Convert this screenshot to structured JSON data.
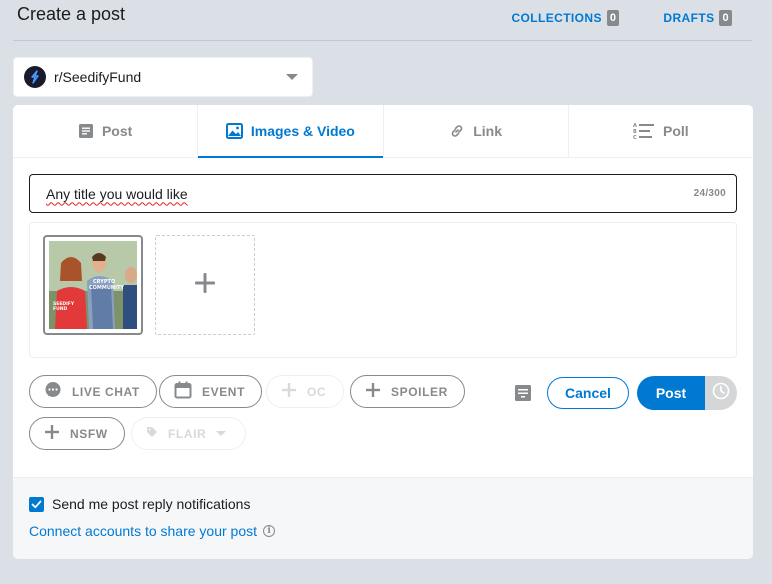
{
  "header": {
    "title": "Create a post",
    "collections_label": "COLLECTIONS",
    "collections_count": "0",
    "drafts_label": "DRAFTS",
    "drafts_count": "0"
  },
  "community": {
    "name": "r/SeedifyFund",
    "icon": "seedify-logo"
  },
  "tabs": [
    {
      "label": "Post",
      "icon": "post-icon",
      "active": false
    },
    {
      "label": "Images & Video",
      "icon": "image-icon",
      "active": true
    },
    {
      "label": "Link",
      "icon": "link-icon",
      "active": false
    },
    {
      "label": "Poll",
      "icon": "poll-icon",
      "active": false
    }
  ],
  "title_field": {
    "value": "Any title you would like",
    "counter": "24/300"
  },
  "media": {
    "thumbnail_captions": [
      "CRYPTO COMMUNITY",
      "SEEDIFY FUND"
    ],
    "add_icon": "plus-icon"
  },
  "tags": {
    "live_chat": "LIVE CHAT",
    "event": "EVENT",
    "oc": "OC",
    "spoiler": "SPOILER",
    "nsfw": "NSFW",
    "flair": "FLAIR"
  },
  "actions": {
    "cancel": "Cancel",
    "post": "Post"
  },
  "footer": {
    "notifications_label": "Send me post reply notifications",
    "notifications_checked": true,
    "connect_label": "Connect accounts to share your post"
  },
  "colors": {
    "accent": "#0079d3",
    "background": "#dae0e6",
    "muted": "#878a8c"
  }
}
